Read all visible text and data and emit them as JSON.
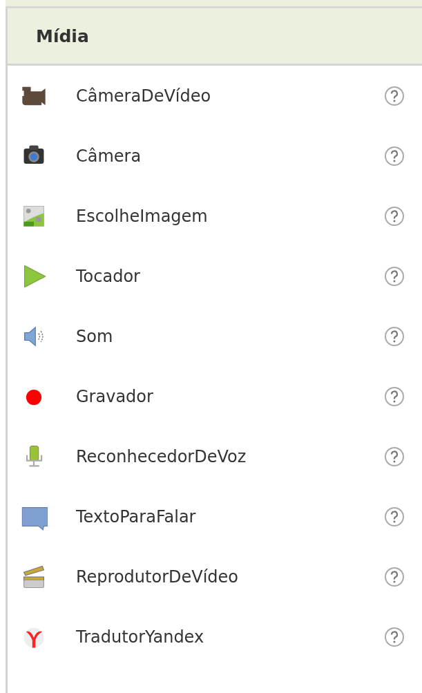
{
  "panel": {
    "title": "Mídia"
  },
  "items": [
    {
      "kind": "videocamera",
      "label": "CâmeraDeVídeo"
    },
    {
      "kind": "camera",
      "label": "Câmera"
    },
    {
      "kind": "imagepicker",
      "label": "EscolheImagem"
    },
    {
      "kind": "player",
      "label": "Tocador"
    },
    {
      "kind": "sound",
      "label": "Som"
    },
    {
      "kind": "recorder",
      "label": "Gravador"
    },
    {
      "kind": "speech",
      "label": "ReconhecedorDeVoz"
    },
    {
      "kind": "tts",
      "label": "TextoParaFalar"
    },
    {
      "kind": "videoplayer",
      "label": "ReprodutorDeVídeo"
    },
    {
      "kind": "translator",
      "label": "TradutorYandex"
    }
  ]
}
